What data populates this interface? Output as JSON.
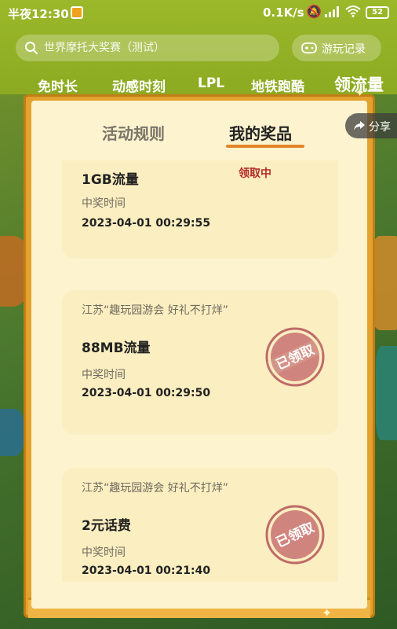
{
  "status_bar": {
    "time": "半夜12:30",
    "net_speed": "0.1K/s",
    "battery": "52"
  },
  "search": {
    "placeholder": "世界摩托大奖赛（测试）"
  },
  "record_button": {
    "label": "游玩记录"
  },
  "categories": [
    {
      "label": "免时长"
    },
    {
      "label": "动感时刻"
    },
    {
      "label": "LPL"
    },
    {
      "label": "地铁跑酷"
    },
    {
      "label": "领流量",
      "active": true
    }
  ],
  "modal": {
    "tabs": {
      "rules": "活动规则",
      "prizes": "我的奖品"
    },
    "prizes": [
      {
        "name": "1GB流量",
        "status": "领取中",
        "time_label": "中奖时间",
        "time": "2023-04-01 00:29:55"
      },
      {
        "event": "江苏“趣玩园游会 好礼不打烊”",
        "name": "88MB流量",
        "stamp": "已领取",
        "time_label": "中奖时间",
        "time": "2023-04-01 00:29:50"
      },
      {
        "event": "江苏“趣玩园游会 好礼不打烊”",
        "name": "2元话费",
        "stamp": "已领取",
        "time_label": "中奖时间",
        "time": "2023-04-01 00:21:40"
      }
    ]
  },
  "share": {
    "label": "分享"
  },
  "colors": {
    "accent": "#e2862a",
    "stamp": "#b3545a",
    "frame": "#e3a22e",
    "card": "#fbeec0"
  }
}
